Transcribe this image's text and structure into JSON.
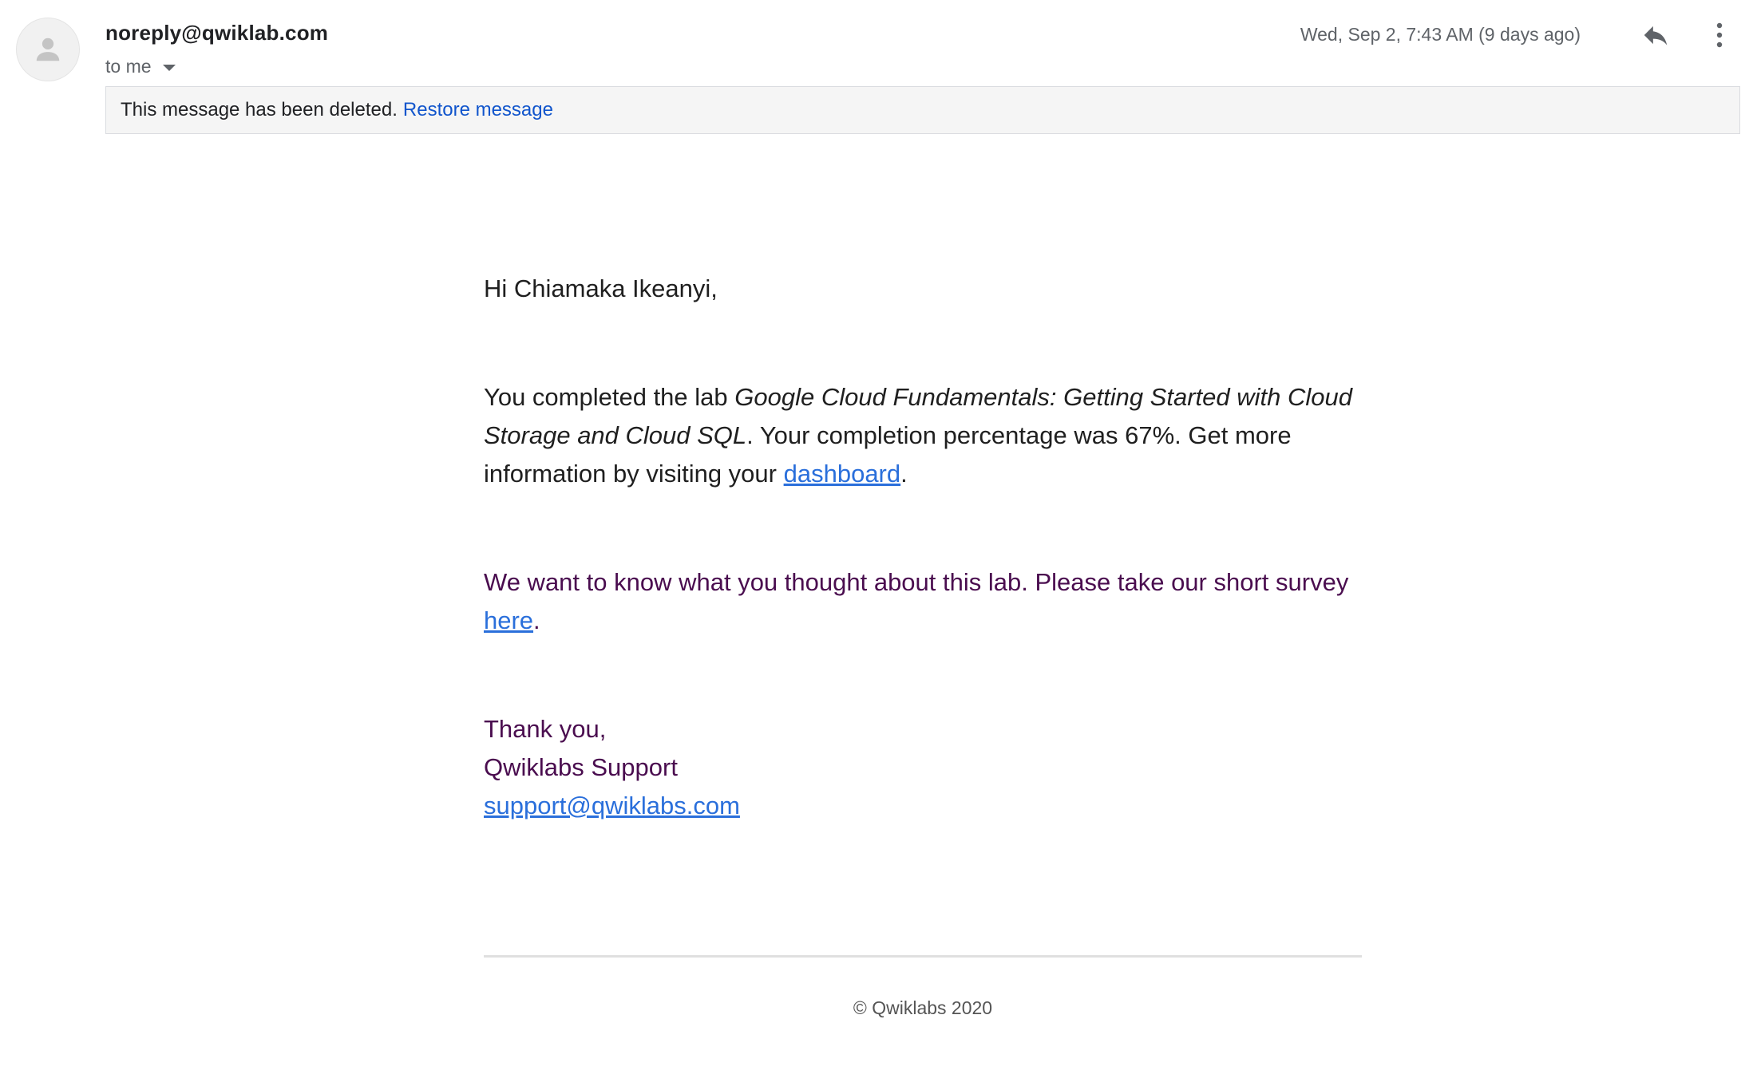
{
  "header": {
    "sender": "noreply@qwiklab.com",
    "recipient_label": "to me",
    "timestamp": "Wed, Sep 2, 7:43 AM (9 days ago)",
    "icons": {
      "avatar": "person-icon",
      "recipient_dropdown": "caret-down-icon",
      "reply": "reply-icon",
      "more": "more-vert-icon"
    }
  },
  "notice": {
    "text": "This message has been deleted.",
    "restore_label": "Restore message"
  },
  "body": {
    "greeting": "Hi Chiamaka Ikeanyi,",
    "completion": {
      "prefix": "You completed the lab ",
      "lab_name": "Google Cloud Fundamentals: Getting Started with Cloud Storage and Cloud SQL",
      "middle": ". Your completion percentage was 67%. Get more information by visiting your ",
      "link_label": "dashboard",
      "suffix": "."
    },
    "survey": {
      "prefix": "We want to know what you thought about this lab. Please take our short survey ",
      "link_label": "here",
      "suffix": "."
    },
    "signoff": {
      "thanks": "Thank you,",
      "team": "Qwiklabs Support",
      "email": "support@qwiklabs.com"
    }
  },
  "footer": {
    "copyright": "© Qwiklabs 2020"
  },
  "colors": {
    "link": "#2a6fdb",
    "restore_link": "#1155cc",
    "survey_text": "#4a0d4f",
    "notice_background": "#f5f5f5"
  }
}
